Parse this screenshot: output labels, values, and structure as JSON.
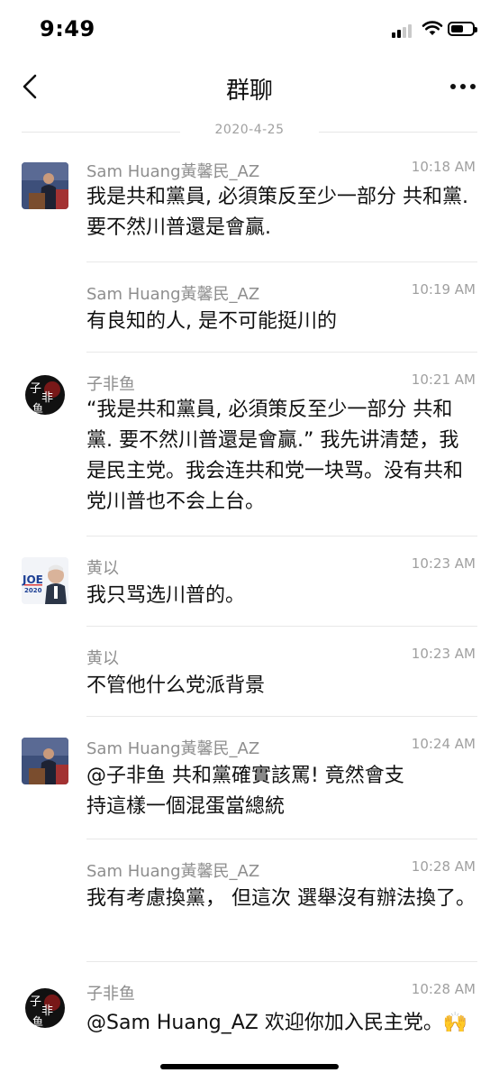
{
  "status_bar": {
    "time": "9:49"
  },
  "nav": {
    "title": "群聊"
  },
  "date_divider": "2020-4-25",
  "messages": [
    {
      "sender": "Sam Huang黃馨民_AZ",
      "time": "10:18 AM",
      "text": "我是共和黨員, 必須策反至少一部分 共和黨. 要不然川普還是會贏."
    },
    {
      "sender": "Sam Huang黃馨民_AZ",
      "time": "10:19 AM",
      "text": "有良知的人, 是不可能挺川的"
    },
    {
      "sender": "子非鱼",
      "time": "10:21 AM",
      "text": "“我是共和黨員, 必須策反至少一部分 共和黨. 要不然川普還是會贏.” 我先讲清楚，我是民主党。我会连共和党一块骂。没有共和党川普也不会上台。"
    },
    {
      "sender": "黄以",
      "time": "10:23 AM",
      "text": "我只骂选川普的。"
    },
    {
      "sender": "黄以",
      "time": "10:23 AM",
      "text": "不管他什么党派背景"
    },
    {
      "sender": "Sam Huang黃馨民_AZ",
      "time": "10:24 AM",
      "text": "@子非鱼 共和黨確實該罵! 竟然會支持這樣一個混蛋當總統"
    },
    {
      "sender": "Sam Huang黃馨民_AZ",
      "time": "10:28 AM",
      "text": "我有考慮換黨， 但這次 選舉沒有辦法換了。"
    },
    {
      "sender": "子非鱼",
      "time": "10:28 AM",
      "text": "@Sam Huang_AZ 欢迎你加入民主党。🙌"
    }
  ],
  "avatars": {
    "sam": {
      "text": ""
    },
    "fish": {
      "text": "子非鱼"
    },
    "joe": {
      "text": "JOE 2020"
    }
  }
}
